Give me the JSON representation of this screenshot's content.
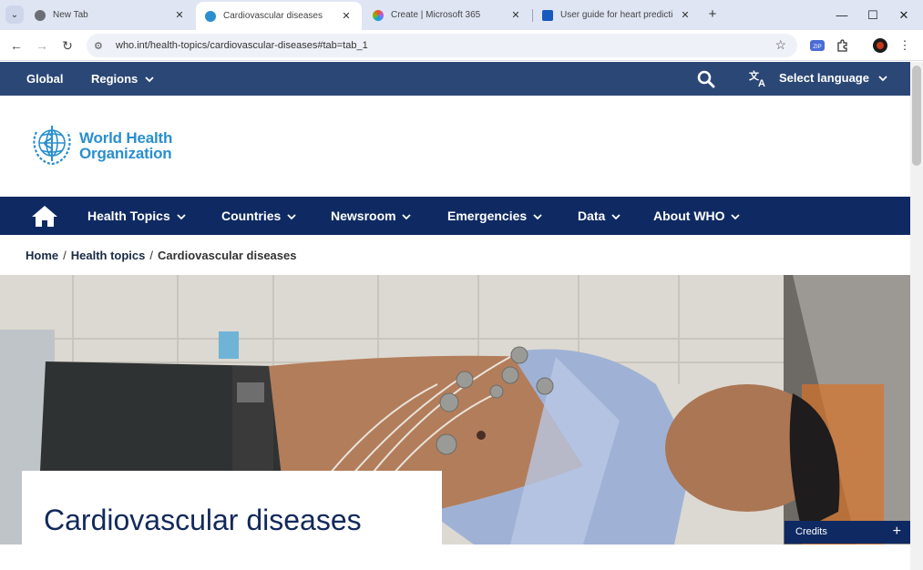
{
  "browser": {
    "tabs": [
      {
        "title": "New Tab",
        "favicon_color": "#5f6368"
      },
      {
        "title": "Cardiovascular diseases",
        "favicon_color": "#2a8fcd"
      },
      {
        "title": "Create | Microsoft 365",
        "favicon_color": "#a264f0"
      },
      {
        "title": "User guide for heart prediction",
        "favicon_color": "#185abd"
      }
    ],
    "url": "who.int/health-topics/cardiovascular-diseases#tab=tab_1",
    "window_controls": {
      "minimize": "—",
      "maximize": "☐",
      "close": "✕"
    },
    "tab_close": "✕",
    "new_tab": "+"
  },
  "who": {
    "topbar": {
      "global": "Global",
      "regions": "Regions",
      "select_language": "Select language"
    },
    "logo": {
      "line1": "World Health",
      "line2": "Organization"
    },
    "nav": [
      "Health Topics",
      "Countries",
      "Newsroom",
      "Emergencies",
      "Data",
      "About WHO"
    ],
    "breadcrumb": {
      "home": "Home",
      "health_topics": "Health topics",
      "current": "Cardiovascular diseases"
    },
    "hero": {
      "title": "Cardiovascular diseases",
      "credits": "Credits",
      "credits_icon": "+"
    }
  },
  "colors": {
    "topbar": "#2b4775",
    "mainnav": "#0f2a63",
    "logo_blue": "#2a8fcd",
    "title_text": "#12295b"
  }
}
